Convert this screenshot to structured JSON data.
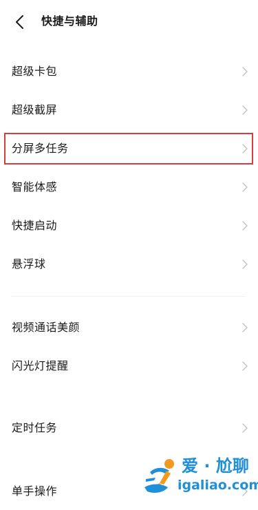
{
  "header": {
    "back_icon": "chevron-left-icon",
    "title": "快捷与辅助"
  },
  "groups": [
    {
      "items": [
        {
          "label": "超级卡包"
        },
        {
          "label": "超级截屏"
        },
        {
          "label": "分屏多任务",
          "highlighted": true
        },
        {
          "label": "智能体感"
        },
        {
          "label": "快捷启动"
        },
        {
          "label": "悬浮球"
        }
      ]
    },
    {
      "items": [
        {
          "label": "视频通话美颜"
        },
        {
          "label": "闪光灯提醒"
        }
      ]
    },
    {
      "items": [
        {
          "label": "定时任务"
        }
      ]
    },
    {
      "items": [
        {
          "label": "单手操作"
        }
      ]
    }
  ],
  "colors": {
    "highlight_border": "#d93a3e",
    "chevron": "#c4c4c4",
    "watermark_blue": "#1f8fd8",
    "watermark_orange": "#f39a1e"
  },
  "watermark": {
    "cn_text": "爱 · 尬聊",
    "en_text": "igaliao.com"
  }
}
